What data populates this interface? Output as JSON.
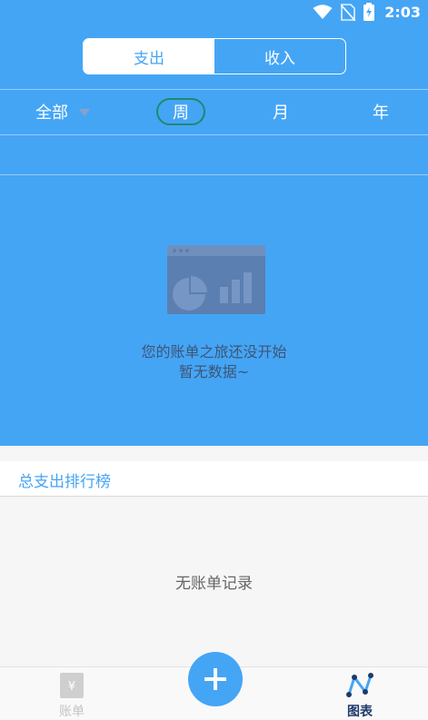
{
  "status_bar": {
    "time": "2:03"
  },
  "toggle": {
    "expense": "支出",
    "income": "收入"
  },
  "filters": {
    "all": "全部",
    "week": "周",
    "month": "月",
    "year": "年"
  },
  "empty_state": {
    "line1": "您的账单之旅还没开始",
    "line2": "暂无数据~"
  },
  "ranking": {
    "title": "总支出排行榜",
    "empty": "无账单记录"
  },
  "bottom_nav": {
    "bills": "账单",
    "charts": "图表",
    "bills_icon_char": "¥"
  },
  "colors": {
    "primary": "#45a5f5",
    "week_ring": "#1e8a6e",
    "empty_text": "#3d5576",
    "active_tab": "#1e3a6a",
    "inactive_tab": "#c4c4c4"
  }
}
